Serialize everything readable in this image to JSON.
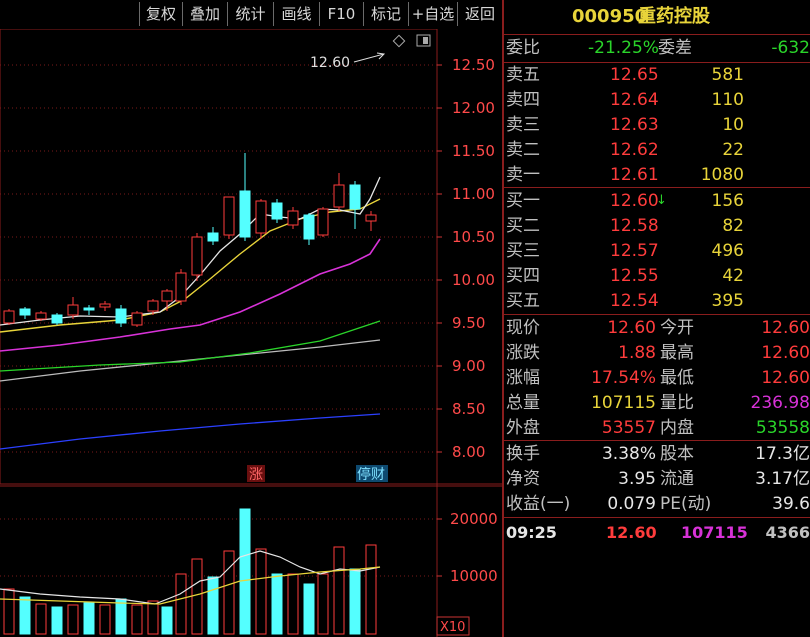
{
  "toolbar": {
    "buttons": [
      "复权",
      "叠加",
      "统计",
      "画线",
      "F10",
      "标记",
      "+自选",
      "返回"
    ]
  },
  "chart_area": {
    "price_axis_ticks": [
      "12.50",
      "12.00",
      "11.50",
      "11.00",
      "10.50",
      "10.00",
      "9.50",
      "9.00",
      "8.50",
      "8.00"
    ],
    "volume_axis_ticks": [
      "20000",
      "10000"
    ],
    "volume_unit": "X10",
    "annotation_price": "12.60",
    "marker_up": "涨",
    "marker_suspend": "停财"
  },
  "quote": {
    "code": "000950",
    "name": "重药控股",
    "weibi_label": "委比",
    "weibi_value": "-21.25%",
    "weicha_label": "委差",
    "weicha_value": "-632",
    "asks": [
      {
        "label": "卖五",
        "price": "12.65",
        "vol": "581"
      },
      {
        "label": "卖四",
        "price": "12.64",
        "vol": "110"
      },
      {
        "label": "卖三",
        "price": "12.63",
        "vol": "10"
      },
      {
        "label": "卖二",
        "price": "12.62",
        "vol": "22"
      },
      {
        "label": "卖一",
        "price": "12.61",
        "vol": "1080"
      }
    ],
    "bids": [
      {
        "label": "买一",
        "price": "12.60",
        "vol": "156"
      },
      {
        "label": "买二",
        "price": "12.58",
        "vol": "82"
      },
      {
        "label": "买三",
        "price": "12.57",
        "vol": "496"
      },
      {
        "label": "买四",
        "price": "12.55",
        "vol": "42"
      },
      {
        "label": "买五",
        "price": "12.54",
        "vol": "395"
      }
    ],
    "stats": [
      {
        "l1": "现价",
        "v1": "12.60",
        "l2": "今开",
        "v2": "12.60"
      },
      {
        "l1": "涨跌",
        "v1": "1.88",
        "l2": "最高",
        "v2": "12.60"
      },
      {
        "l1": "涨幅",
        "v1": "17.54%",
        "l2": "最低",
        "v2": "12.60"
      },
      {
        "l1": "总量",
        "v1": "107115",
        "l2": "量比",
        "v2": "236.98"
      },
      {
        "l1": "外盘",
        "v1": "53557",
        "l2": "内盘",
        "v2": "53558"
      }
    ],
    "fund": [
      {
        "l1": "换手",
        "v1": "3.38%",
        "l2": "股本",
        "v2": "17.3亿"
      },
      {
        "l1": "净资",
        "v1": "3.95",
        "l2": "流通",
        "v2": "3.17亿"
      },
      {
        "l1": "收益(一)",
        "v1": "0.079",
        "l2": "PE(动)",
        "v2": "39.6"
      }
    ],
    "tick": {
      "time": "09:25",
      "price": "12.60",
      "volume": "107115",
      "count": "4366"
    }
  },
  "colors": {
    "up": "#ff3c3c",
    "down": "#54ffff",
    "border": "#8a1d1d"
  }
}
